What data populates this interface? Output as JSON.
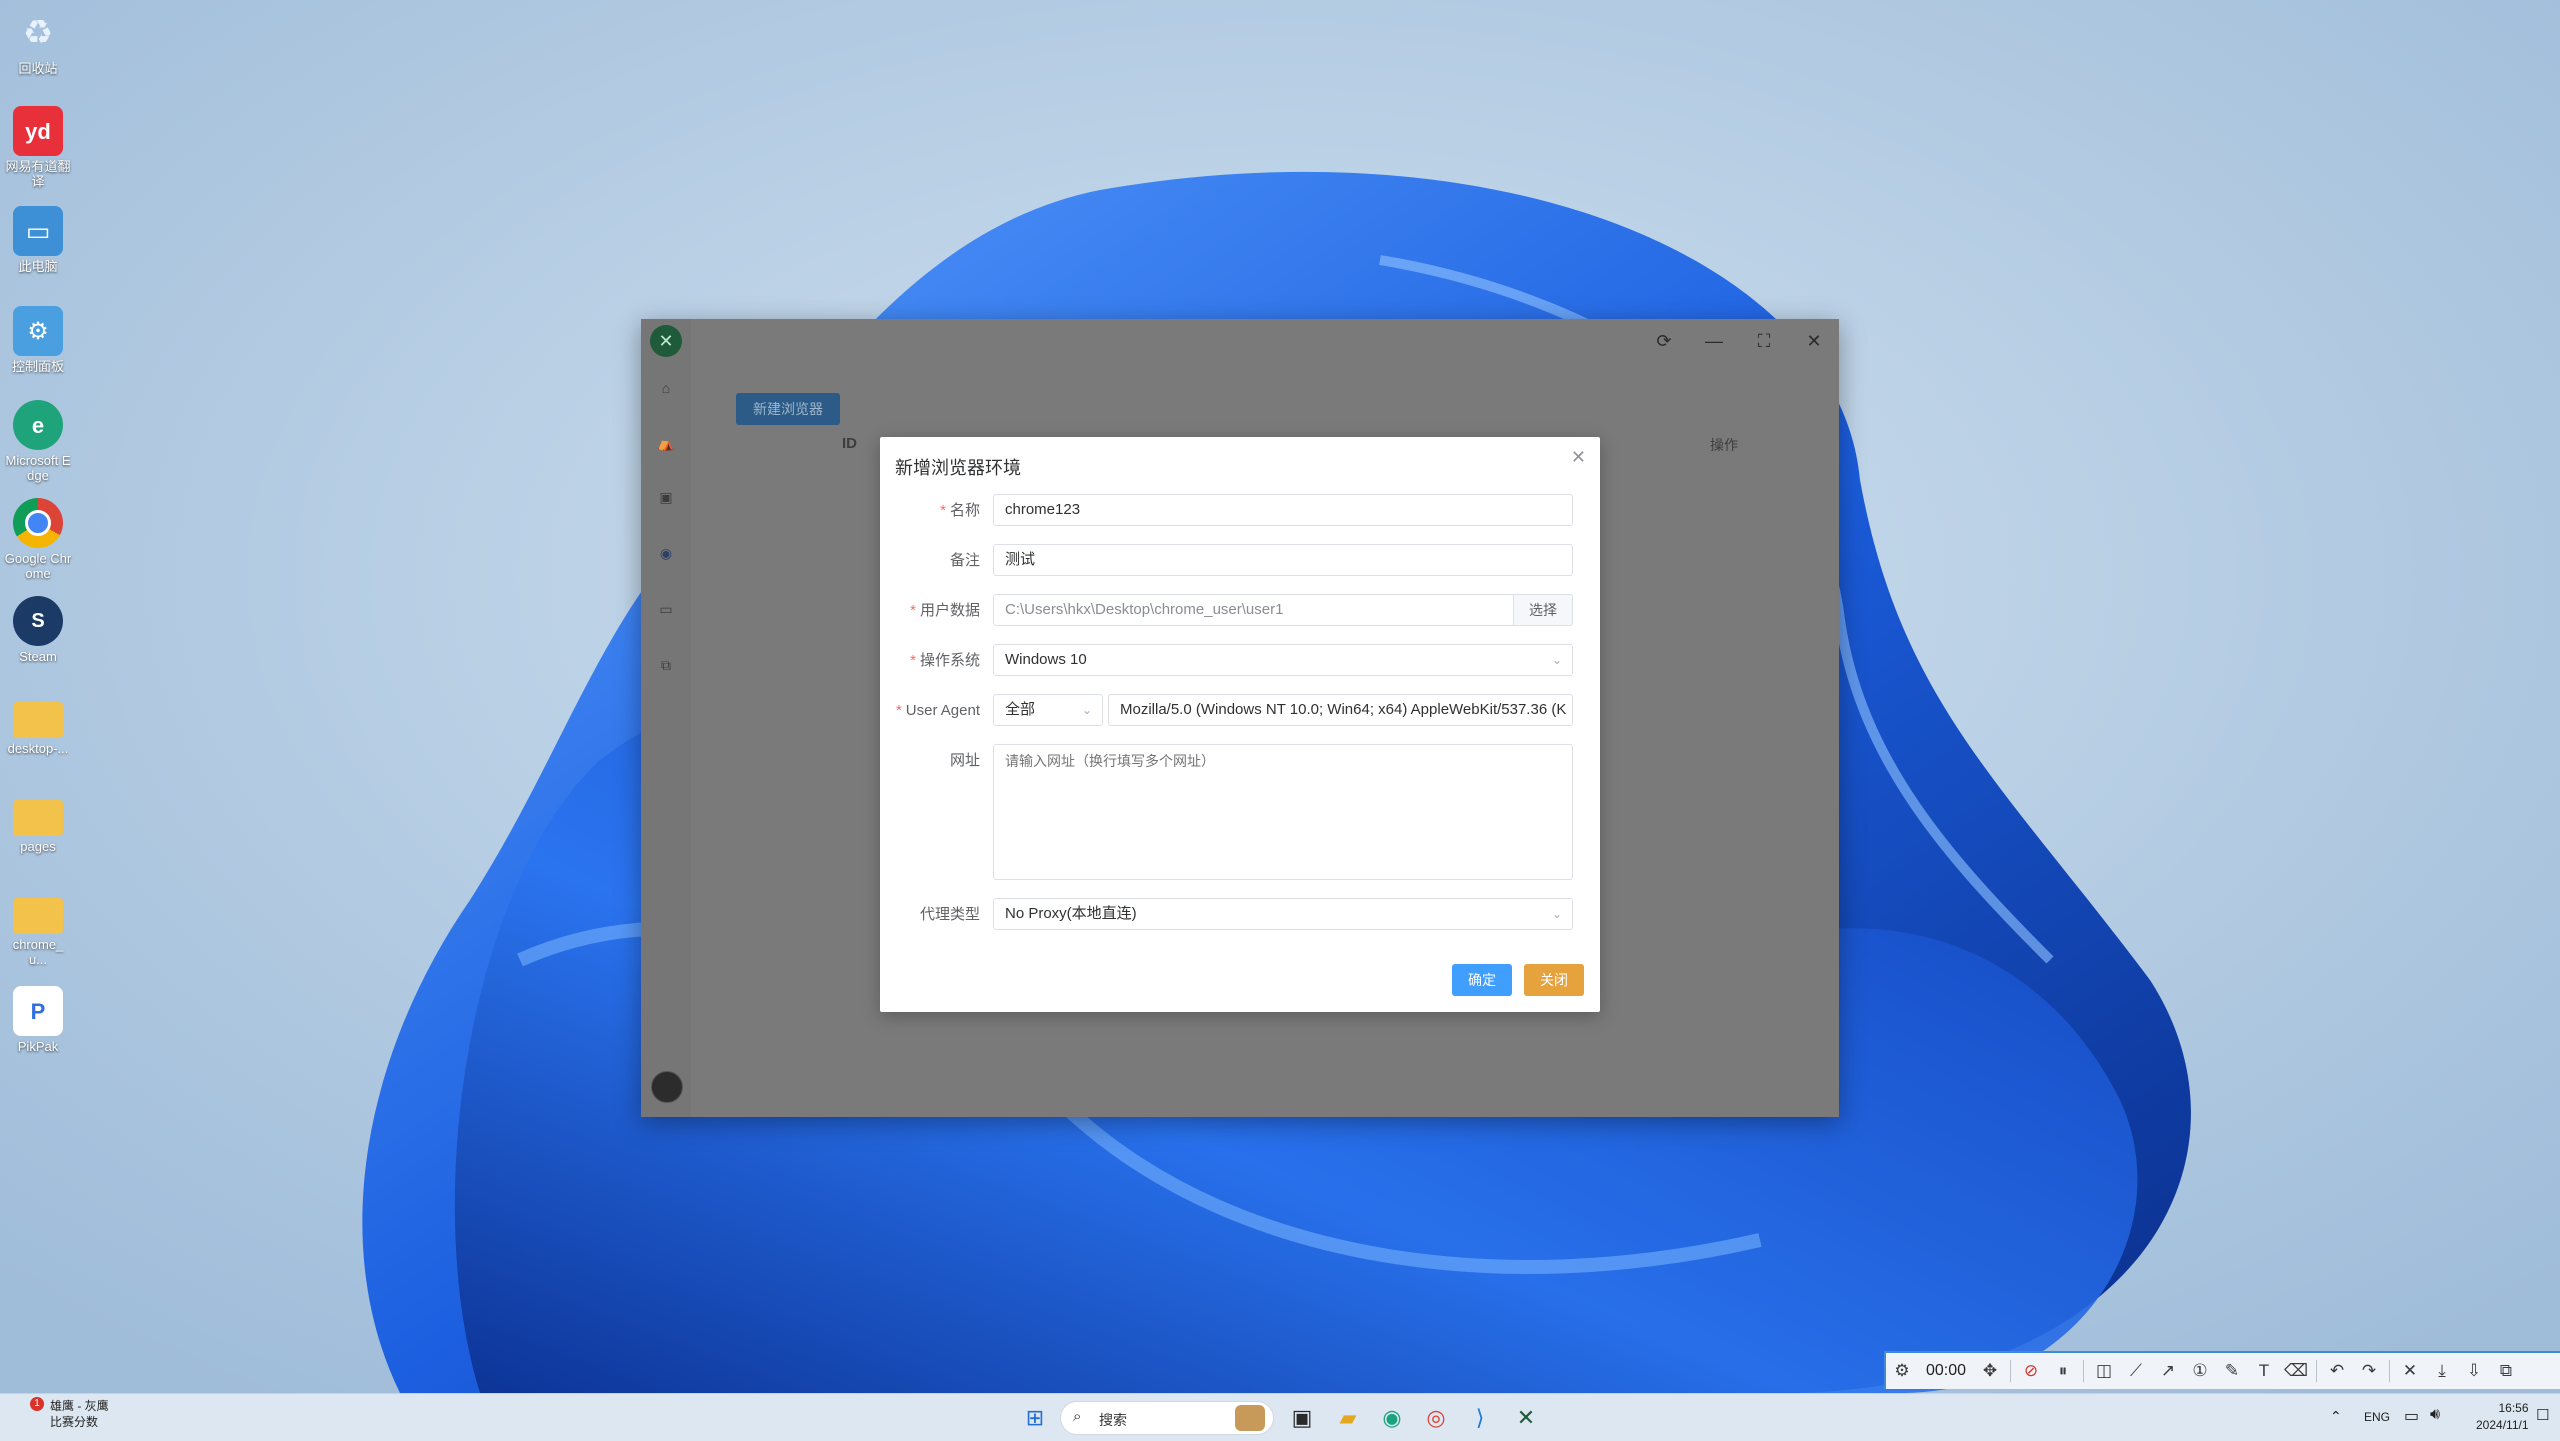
{
  "desktop": {
    "icons": [
      {
        "label": "回收站"
      },
      {
        "label": "网易有道翻译"
      },
      {
        "label": "此电脑"
      },
      {
        "label": "控制面板"
      },
      {
        "label": "Microsoft Edge"
      },
      {
        "label": "Google Chrome"
      },
      {
        "label": "Steam"
      },
      {
        "label": "desktop-..."
      },
      {
        "label": "pages"
      },
      {
        "label": "chrome_u..."
      },
      {
        "label": "PikPak"
      }
    ]
  },
  "app": {
    "new_browser_label": "新建浏览器",
    "table_headers": {
      "id": "ID",
      "actions": "操作"
    },
    "window_controls": {
      "refresh": "⟳",
      "minimize": "—",
      "maximize": "⛶",
      "close": "✕"
    }
  },
  "modal": {
    "title": "新增浏览器环境",
    "close_icon": "✕",
    "fields": {
      "name": {
        "label": "名称",
        "value": "chrome123",
        "required": true
      },
      "remark": {
        "label": "备注",
        "value": "测试",
        "required": false
      },
      "user_data": {
        "label": "用户数据",
        "value": "C:\\Users\\hkx\\Desktop\\chrome_user\\user1",
        "button": "选择",
        "required": true
      },
      "os": {
        "label": "操作系统",
        "value": "Windows 10",
        "required": true
      },
      "user_agent": {
        "label": "User Agent",
        "filter": "全部",
        "value": "Mozilla/5.0 (Windows NT 10.0; Win64; x64) AppleWebKit/537.36 (K",
        "required": true
      },
      "url": {
        "label": "网址",
        "placeholder": "请输入网址（换行填写多个网址）",
        "required": false
      },
      "proxy": {
        "label": "代理类型",
        "value": "No Proxy(本地直连)",
        "required": false
      }
    },
    "confirm_label": "确定",
    "close_label": "关闭"
  },
  "recorder": {
    "timer": "00:00"
  },
  "taskbar": {
    "weather_title": "雄鹰 - 灰鹰",
    "weather_sub": "比赛分数",
    "weather_badge": "1",
    "search_label": "搜索",
    "lang": "ENG",
    "time": "16:56",
    "date": "2024/11/1"
  },
  "colors": {
    "primary": "#409eff",
    "warning": "#e6a23c",
    "required": "#f56c6c",
    "app_accent": "#2b5b86"
  }
}
